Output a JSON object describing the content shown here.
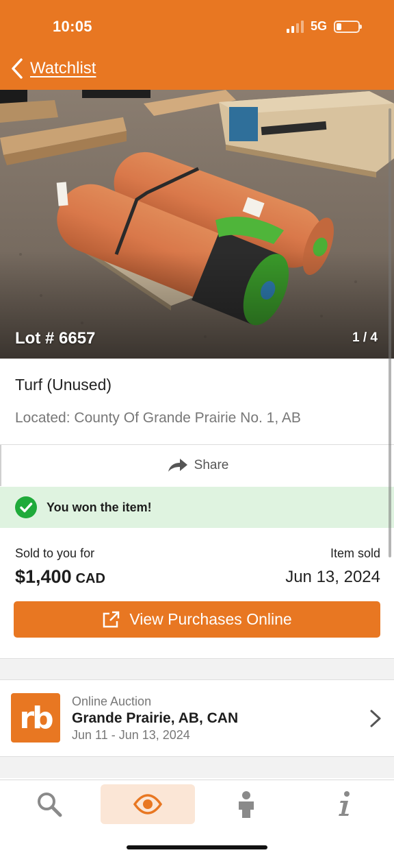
{
  "status_bar": {
    "time": "10:05",
    "network": "5G"
  },
  "nav": {
    "back_label": "Watchlist"
  },
  "hero": {
    "lot_label": "Lot # 6657",
    "photo_counter": "1 / 4"
  },
  "item": {
    "title": "Turf (Unused)",
    "location": "Located: County Of Grande Prairie No. 1, AB"
  },
  "share": {
    "label": "Share"
  },
  "won_banner": {
    "text": "You won the item!"
  },
  "sale": {
    "sold_label": "Sold to you for",
    "price": "$1,400",
    "currency": "CAD",
    "item_sold_label": "Item sold",
    "item_sold_date": "Jun 13, 2024"
  },
  "cta": {
    "label": "View Purchases Online"
  },
  "auction": {
    "logo_text": "rb",
    "type": "Online Auction",
    "place": "Grande Prairie, AB, CAN",
    "dates": "Jun 11 - Jun 13, 2024"
  },
  "tabbar": {
    "tabs": [
      {
        "icon": "search-icon",
        "active": false
      },
      {
        "icon": "eye-icon",
        "active": true
      },
      {
        "icon": "person-icon",
        "active": false
      },
      {
        "icon": "info-icon",
        "active": false
      }
    ]
  },
  "colors": {
    "brand": "#e87722",
    "success": "#1faa3a",
    "success_bg": "#dff3e0"
  }
}
